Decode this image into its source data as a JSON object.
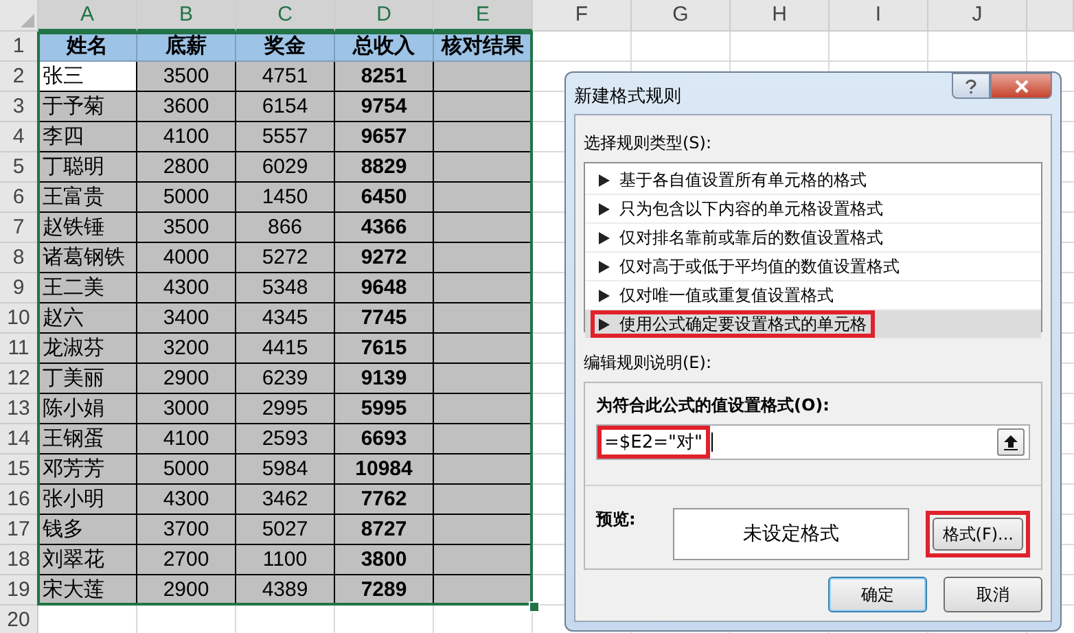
{
  "sheet": {
    "columns": [
      "A",
      "B",
      "C",
      "D",
      "E",
      "F",
      "G",
      "H",
      "I",
      "J"
    ],
    "header_row": {
      "number": "1",
      "cells": [
        "姓名",
        "底薪",
        "奖金",
        "总收入",
        "核对结果"
      ]
    },
    "rows": [
      {
        "number": "2",
        "cells": [
          "张三",
          "3500",
          "4751",
          "8251",
          ""
        ],
        "active": true
      },
      {
        "number": "3",
        "cells": [
          "于予菊",
          "3600",
          "6154",
          "9754",
          ""
        ],
        "active": false
      },
      {
        "number": "4",
        "cells": [
          "李四",
          "4100",
          "5557",
          "9657",
          ""
        ],
        "active": false
      },
      {
        "number": "5",
        "cells": [
          "丁聪明",
          "2800",
          "6029",
          "8829",
          ""
        ],
        "active": false
      },
      {
        "number": "6",
        "cells": [
          "王富贵",
          "5000",
          "1450",
          "6450",
          ""
        ],
        "active": false
      },
      {
        "number": "7",
        "cells": [
          "赵铁锤",
          "3500",
          "866",
          "4366",
          ""
        ],
        "active": false
      },
      {
        "number": "8",
        "cells": [
          "诸葛钢铁",
          "4000",
          "5272",
          "9272",
          ""
        ],
        "active": false
      },
      {
        "number": "9",
        "cells": [
          "王二美",
          "4300",
          "5348",
          "9648",
          ""
        ],
        "active": false
      },
      {
        "number": "10",
        "cells": [
          "赵六",
          "3400",
          "4345",
          "7745",
          ""
        ],
        "active": false
      },
      {
        "number": "11",
        "cells": [
          "龙淑芬",
          "3200",
          "4415",
          "7615",
          ""
        ],
        "active": false
      },
      {
        "number": "12",
        "cells": [
          "丁美丽",
          "2900",
          "6239",
          "9139",
          ""
        ],
        "active": false
      },
      {
        "number": "13",
        "cells": [
          "陈小娟",
          "3000",
          "2995",
          "5995",
          ""
        ],
        "active": false
      },
      {
        "number": "14",
        "cells": [
          "王钢蛋",
          "4100",
          "2593",
          "6693",
          ""
        ],
        "active": false
      },
      {
        "number": "15",
        "cells": [
          "邓芳芳",
          "5000",
          "5984",
          "10984",
          ""
        ],
        "active": false
      },
      {
        "number": "16",
        "cells": [
          "张小明",
          "4300",
          "3462",
          "7762",
          ""
        ],
        "active": false
      },
      {
        "number": "17",
        "cells": [
          "钱多",
          "3700",
          "5027",
          "8727",
          ""
        ],
        "active": false
      },
      {
        "number": "18",
        "cells": [
          "刘翠花",
          "2700",
          "1100",
          "3800",
          ""
        ],
        "active": false
      },
      {
        "number": "19",
        "cells": [
          "宋大莲",
          "2900",
          "4389",
          "7289",
          ""
        ],
        "active": false
      }
    ],
    "empty_rows": [
      "20"
    ]
  },
  "dialog": {
    "title": "新建格式规则",
    "rule_type_label": "选择规则类型(S):",
    "rule_types": [
      {
        "label": "基于各自值设置所有单元格的格式",
        "selected": false,
        "highlighted": false
      },
      {
        "label": "只为包含以下内容的单元格设置格式",
        "selected": false,
        "highlighted": false
      },
      {
        "label": "仅对排名靠前或靠后的数值设置格式",
        "selected": false,
        "highlighted": false
      },
      {
        "label": "仅对高于或低于平均值的数值设置格式",
        "selected": false,
        "highlighted": false
      },
      {
        "label": "仅对唯一值或重复值设置格式",
        "selected": false,
        "highlighted": false
      },
      {
        "label": "使用公式确定要设置格式的单元格",
        "selected": true,
        "highlighted": true
      }
    ],
    "edit_label": "编辑规则说明(E):",
    "formula_label": "为符合此公式的值设置格式(O):",
    "formula": {
      "value": "=$E2=\"对\"",
      "highlighted": true
    },
    "preview_label": "预览:",
    "preview_text": "未设定格式",
    "format_button": {
      "label": "格式(F)...",
      "highlighted": true
    },
    "buttons": [
      "确定",
      "取消"
    ]
  }
}
